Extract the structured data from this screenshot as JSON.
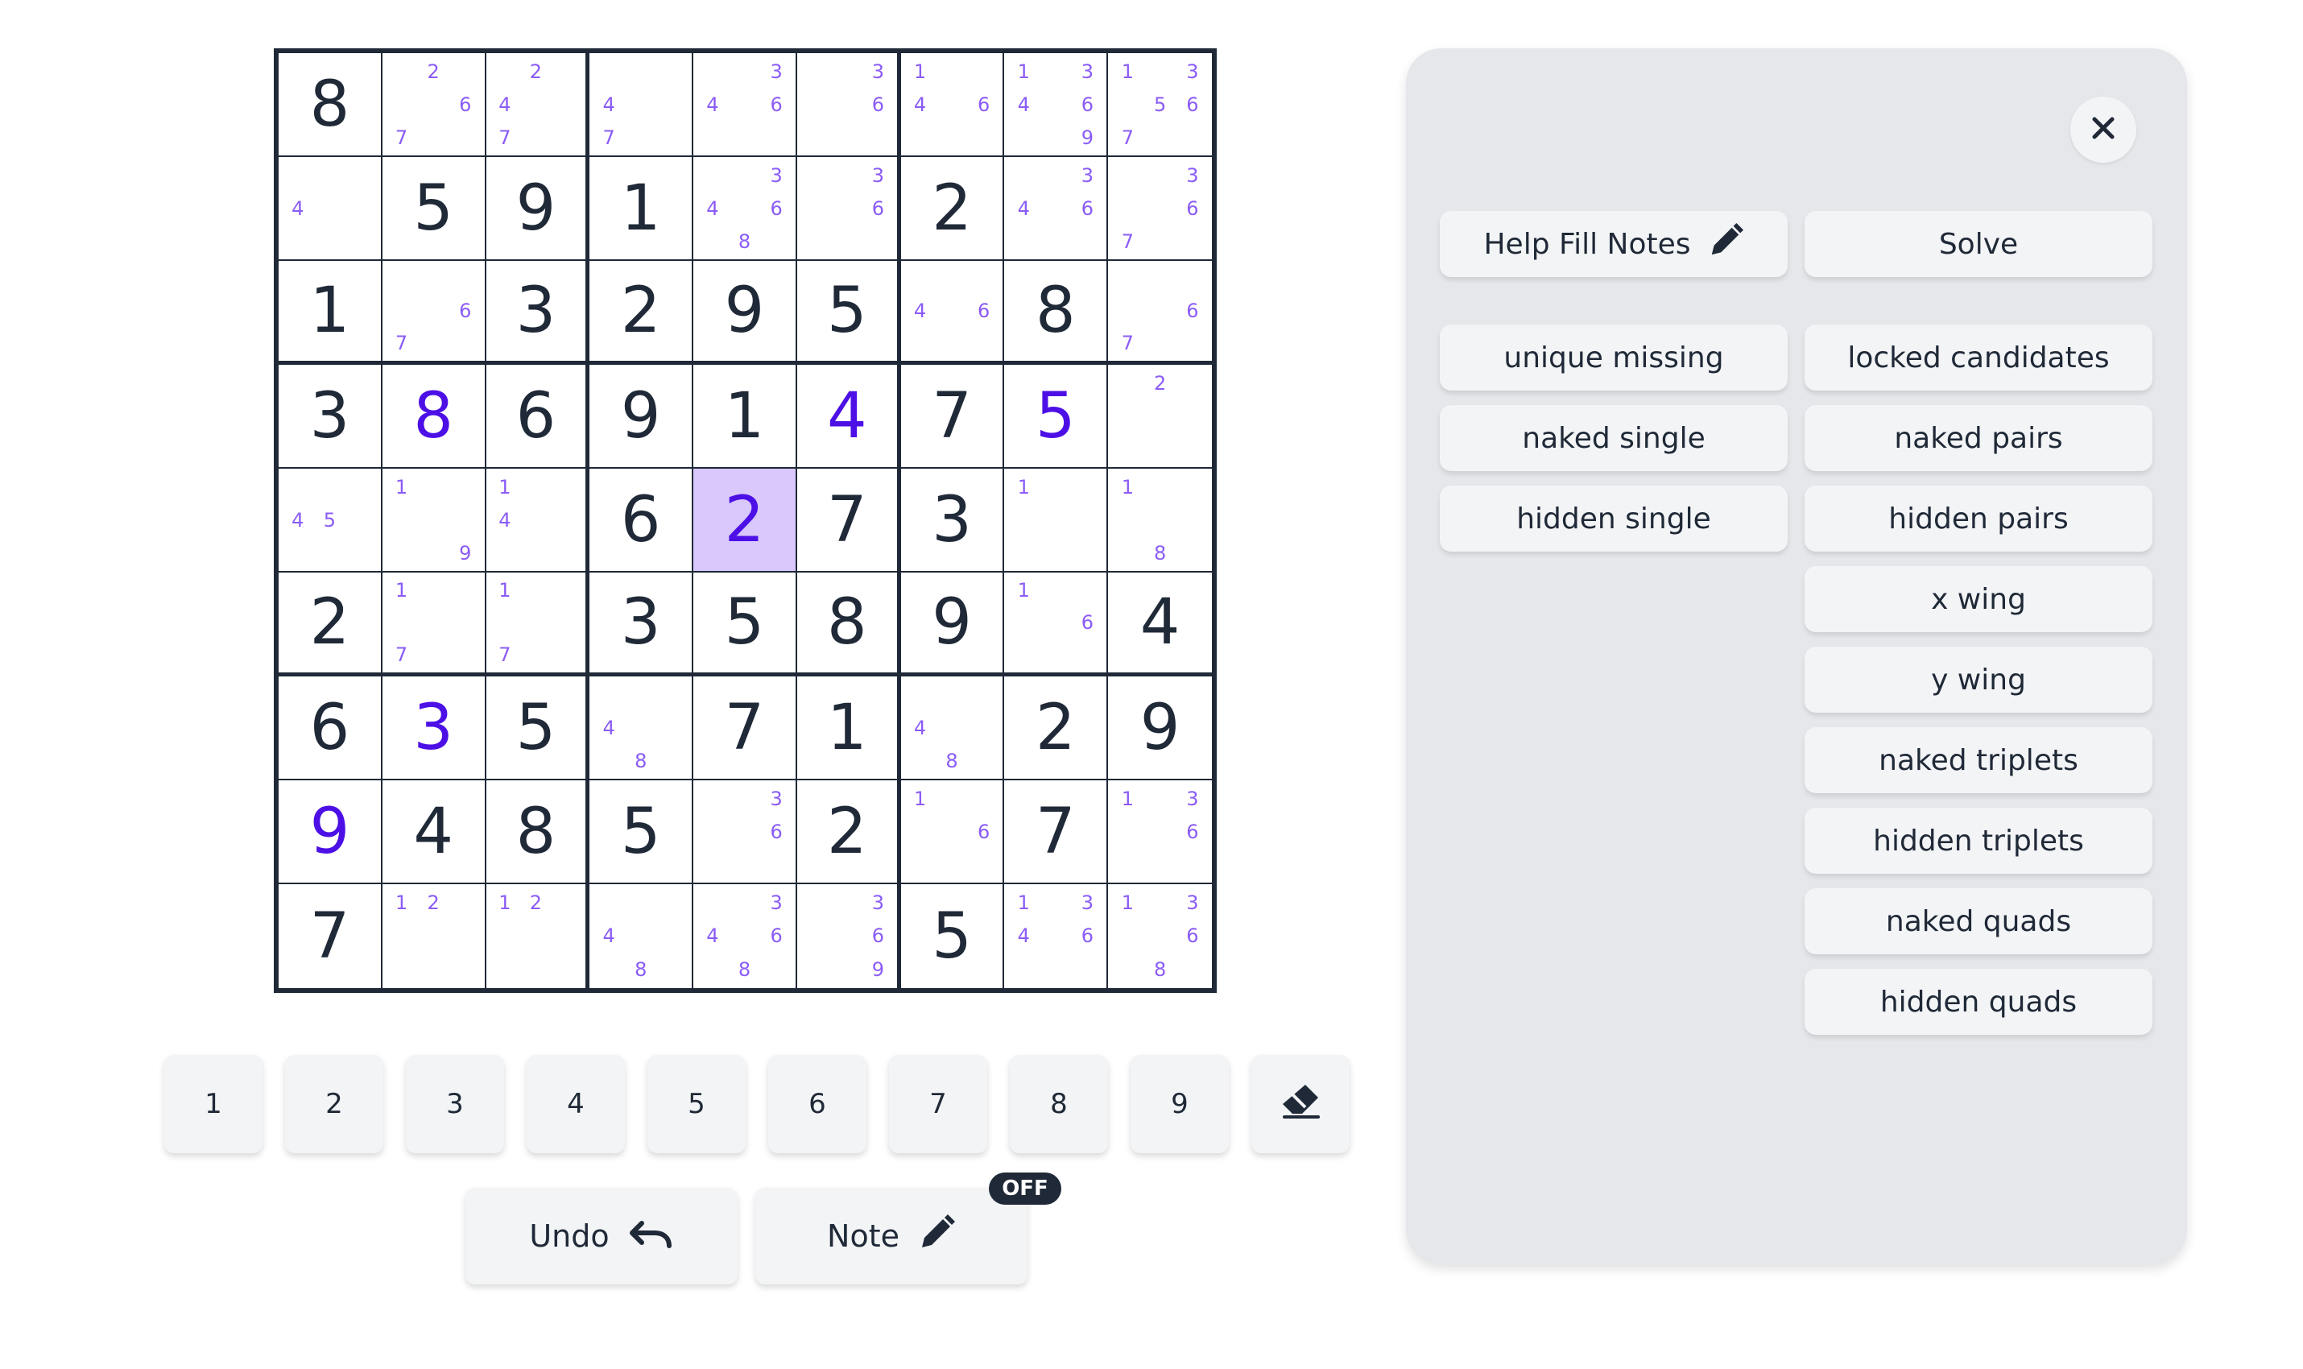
{
  "board": {
    "selected": [
      4,
      4
    ],
    "cells": [
      [
        {
          "v": "8"
        },
        {
          "n": [
            2,
            6,
            7
          ]
        },
        {
          "n": [
            2,
            4,
            7
          ]
        },
        {
          "n": [
            4,
            7
          ]
        },
        {
          "n": [
            3,
            4,
            6
          ]
        },
        {
          "n": [
            3,
            6
          ]
        },
        {
          "n": [
            1,
            4,
            6
          ]
        },
        {
          "n": [
            1,
            3,
            4,
            6,
            9
          ]
        },
        {
          "n": [
            1,
            3,
            5,
            6,
            7
          ]
        }
      ],
      [
        {
          "n": [
            4
          ]
        },
        {
          "v": "5"
        },
        {
          "v": "9"
        },
        {
          "v": "1"
        },
        {
          "n": [
            3,
            4,
            6,
            8
          ]
        },
        {
          "n": [
            3,
            6
          ]
        },
        {
          "v": "2"
        },
        {
          "n": [
            3,
            4,
            6
          ]
        },
        {
          "n": [
            3,
            6,
            7
          ]
        }
      ],
      [
        {
          "v": "1"
        },
        {
          "n": [
            6,
            7
          ]
        },
        {
          "v": "3"
        },
        {
          "v": "2"
        },
        {
          "v": "9"
        },
        {
          "v": "5"
        },
        {
          "n": [
            4,
            6
          ]
        },
        {
          "v": "8"
        },
        {
          "n": [
            6,
            7
          ]
        }
      ],
      [
        {
          "v": "3"
        },
        {
          "v": "8",
          "u": true
        },
        {
          "v": "6"
        },
        {
          "v": "9"
        },
        {
          "v": "1"
        },
        {
          "v": "4",
          "u": true
        },
        {
          "v": "7"
        },
        {
          "v": "5",
          "u": true
        },
        {
          "n": [
            2
          ]
        }
      ],
      [
        {
          "n": [
            4,
            5
          ]
        },
        {
          "n": [
            1,
            9
          ]
        },
        {
          "n": [
            1,
            4
          ]
        },
        {
          "v": "6"
        },
        {
          "v": "2",
          "u": true
        },
        {
          "v": "7"
        },
        {
          "v": "3"
        },
        {
          "n": [
            1
          ]
        },
        {
          "n": [
            1,
            8
          ]
        }
      ],
      [
        {
          "v": "2"
        },
        {
          "n": [
            1,
            7
          ]
        },
        {
          "n": [
            1,
            7
          ]
        },
        {
          "v": "3"
        },
        {
          "v": "5"
        },
        {
          "v": "8"
        },
        {
          "v": "9"
        },
        {
          "n": [
            1,
            6
          ]
        },
        {
          "v": "4"
        }
      ],
      [
        {
          "v": "6"
        },
        {
          "v": "3",
          "u": true
        },
        {
          "v": "5"
        },
        {
          "n": [
            4,
            8
          ]
        },
        {
          "v": "7"
        },
        {
          "v": "1"
        },
        {
          "n": [
            4,
            8
          ]
        },
        {
          "v": "2"
        },
        {
          "v": "9"
        }
      ],
      [
        {
          "v": "9",
          "u": true
        },
        {
          "v": "4"
        },
        {
          "v": "8"
        },
        {
          "v": "5"
        },
        {
          "n": [
            3,
            6
          ]
        },
        {
          "v": "2"
        },
        {
          "n": [
            1,
            6
          ]
        },
        {
          "v": "7"
        },
        {
          "n": [
            1,
            3,
            6
          ]
        }
      ],
      [
        {
          "v": "7"
        },
        {
          "n": [
            1,
            2
          ]
        },
        {
          "n": [
            1,
            2
          ]
        },
        {
          "n": [
            4,
            8
          ]
        },
        {
          "n": [
            3,
            4,
            6,
            8
          ]
        },
        {
          "n": [
            3,
            6,
            9
          ]
        },
        {
          "v": "5"
        },
        {
          "n": [
            1,
            3,
            4,
            6
          ]
        },
        {
          "n": [
            1,
            3,
            6,
            8
          ]
        }
      ]
    ]
  },
  "numpad": {
    "digits": [
      "1",
      "2",
      "3",
      "4",
      "5",
      "6",
      "7",
      "8",
      "9"
    ],
    "eraser_icon": "eraser-icon"
  },
  "actions": {
    "undo_label": "Undo",
    "undo_icon": "undo-icon",
    "note_label": "Note",
    "note_icon": "pencil-icon",
    "note_state": "OFF"
  },
  "panel": {
    "close_icon": "close-icon",
    "help_fill_notes_label": "Help Fill Notes",
    "solve_label": "Solve",
    "strategies_left": [
      "unique missing",
      "naked single",
      "hidden single"
    ],
    "strategies_right": [
      "locked candidates",
      "naked pairs",
      "hidden pairs",
      "x wing",
      "y wing",
      "naked triplets",
      "hidden triplets",
      "naked quads",
      "hidden quads"
    ]
  },
  "colors": {
    "given": "#1f2937",
    "user_entry": "#4c10e6",
    "note": "#8b5cf6",
    "selected_cell": "#d8c8fb",
    "panel_bg": "#e5e7eb",
    "button_bg": "#f3f4f6"
  }
}
